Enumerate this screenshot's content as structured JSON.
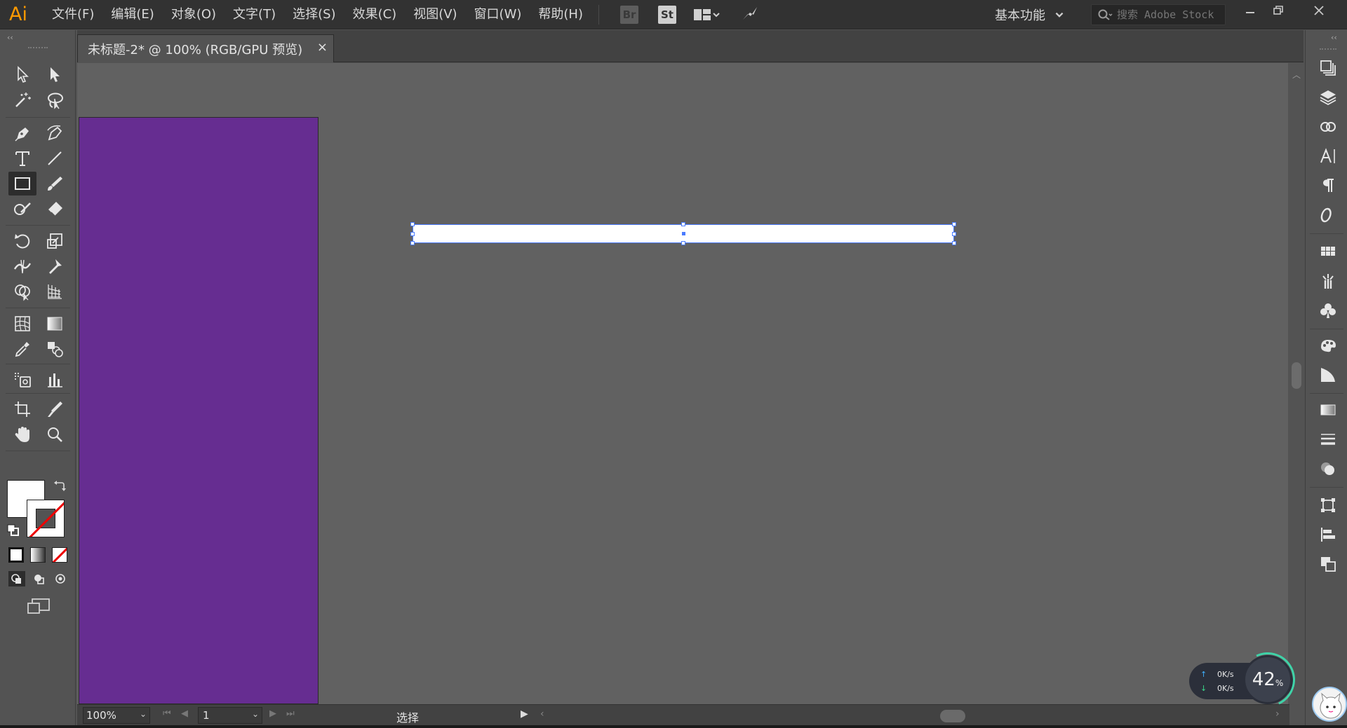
{
  "app": {
    "logo": "Ai"
  },
  "menu": [
    "文件(F)",
    "编辑(E)",
    "对象(O)",
    "文字(T)",
    "选择(S)",
    "效果(C)",
    "视图(V)",
    "窗口(W)",
    "帮助(H)"
  ],
  "toolbar_apps": {
    "bridge": "Br",
    "stock": "St"
  },
  "workspace": {
    "label": "基本功能"
  },
  "search": {
    "placeholder": "搜索 Adobe Stock"
  },
  "document_tab": {
    "title": "未标题-2* @ 100% (RGB/GPU 预览)",
    "close": "×"
  },
  "status_bar": {
    "zoom": "100%",
    "page": "1",
    "tool_label": "选择"
  },
  "colors": {
    "artboard": "#662d91",
    "selection": "#4a7bff",
    "fill": "#ffffff",
    "canvas": "#616161",
    "logo": "#ff9a00"
  },
  "net_widget": {
    "upload": "0K/s",
    "download": "0K/s",
    "percent": "42",
    "percent_unit": "%"
  }
}
